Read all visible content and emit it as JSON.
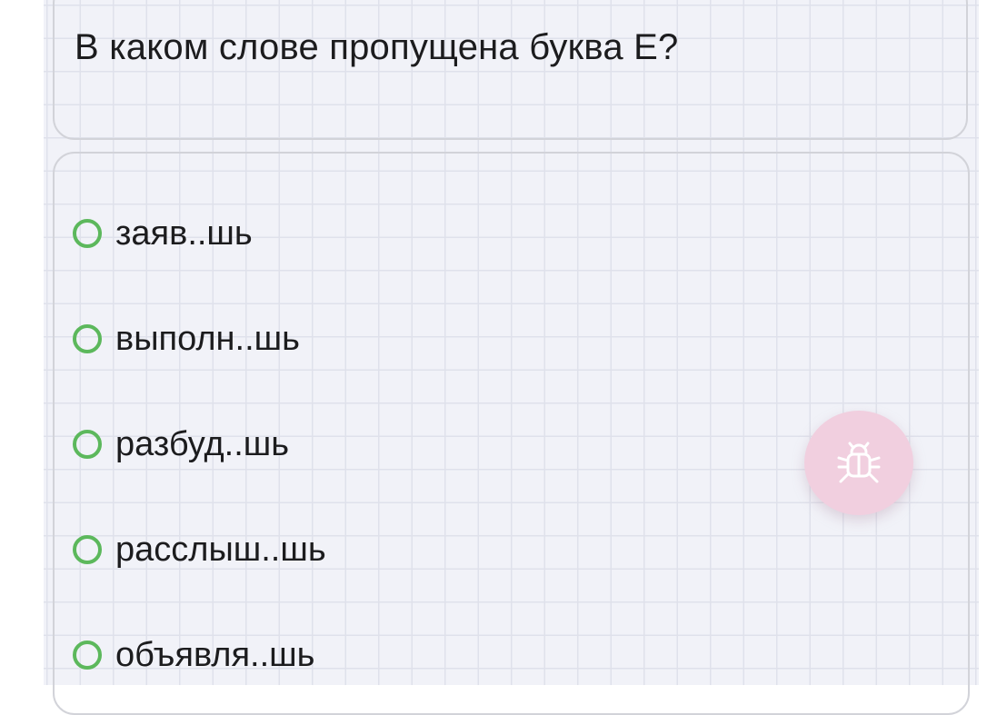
{
  "question": {
    "text": "В каком слове пропущена буква Е?"
  },
  "options": [
    {
      "label": "заяв..шь"
    },
    {
      "label": "выполн..шь"
    },
    {
      "label": "разбуд..шь"
    },
    {
      "label": "расслыш..шь"
    },
    {
      "label": "объявля..шь"
    }
  ],
  "colors": {
    "radio": "#5cb85c",
    "bug_button": "#f1cfdf",
    "background_grid": "#f1f2f8"
  },
  "debug_button": {
    "icon": "bug-icon"
  }
}
